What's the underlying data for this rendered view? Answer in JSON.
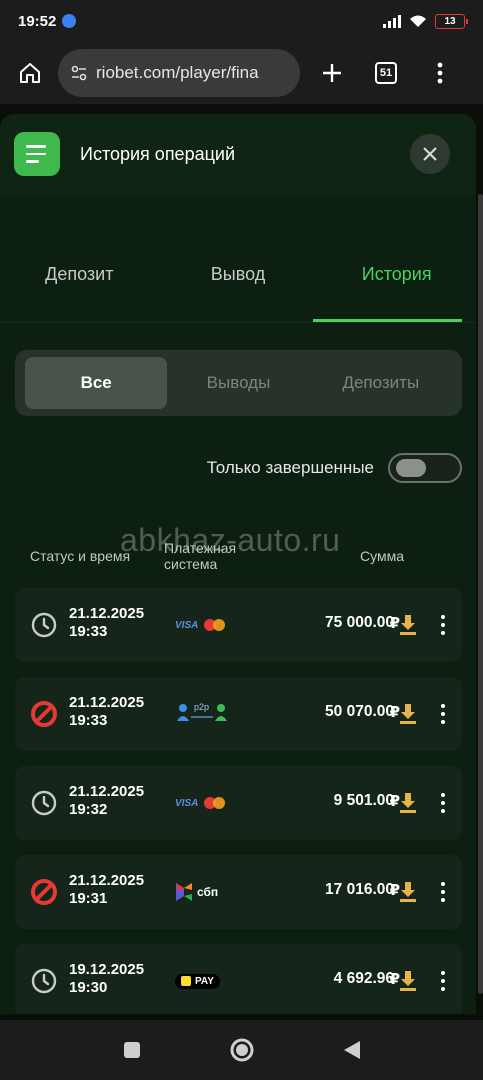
{
  "status_bar": {
    "time": "19:52",
    "battery": "13"
  },
  "browser": {
    "url": "riobet.com/player/fina",
    "tab_count": "51"
  },
  "panel": {
    "title": "История операций"
  },
  "tabs": [
    {
      "label": "Депозит",
      "active": false
    },
    {
      "label": "Вывод",
      "active": false
    },
    {
      "label": "История",
      "active": true
    }
  ],
  "filter": {
    "segments": [
      {
        "label": "Все",
        "active": true
      },
      {
        "label": "Выводы",
        "active": false
      },
      {
        "label": "Депозиты",
        "active": false
      }
    ],
    "only_completed_label": "Только завершенные",
    "only_completed_on": false
  },
  "watermark": "abkhaz-auto.ru",
  "columns": {
    "status_time": "Статус и время",
    "payment_system_line1": "Платежная",
    "payment_system_line2": "система",
    "amount": "Сумма"
  },
  "operations": [
    {
      "status": "pending",
      "date": "21.12.2025",
      "time": "19:33",
      "payment": "visa-mastercard",
      "amount": "75 000.00",
      "currency": "₽"
    },
    {
      "status": "cancelled",
      "date": "21.12.2025",
      "time": "19:33",
      "payment": "p2p",
      "amount": "50 070.00",
      "currency": "₽"
    },
    {
      "status": "pending",
      "date": "21.12.2025",
      "time": "19:32",
      "payment": "visa-mastercard",
      "amount": "9 501.00",
      "currency": "₽"
    },
    {
      "status": "cancelled",
      "date": "21.12.2025",
      "time": "19:31",
      "payment": "sbp",
      "amount": "17 016.00",
      "currency": "₽"
    },
    {
      "status": "pending",
      "date": "19.12.2025",
      "time": "19:30",
      "payment": "tpay",
      "amount": "4 692.96",
      "currency": "₽"
    }
  ],
  "payment_labels": {
    "visa": "VISA",
    "p2p": "p2p",
    "sbp": "сбп",
    "tpay": "PAY"
  },
  "colors": {
    "accent_green": "#4cd060",
    "brand_green": "#3fb84d",
    "cancel_red": "#e53935",
    "download_gold": "#e8b24a"
  }
}
